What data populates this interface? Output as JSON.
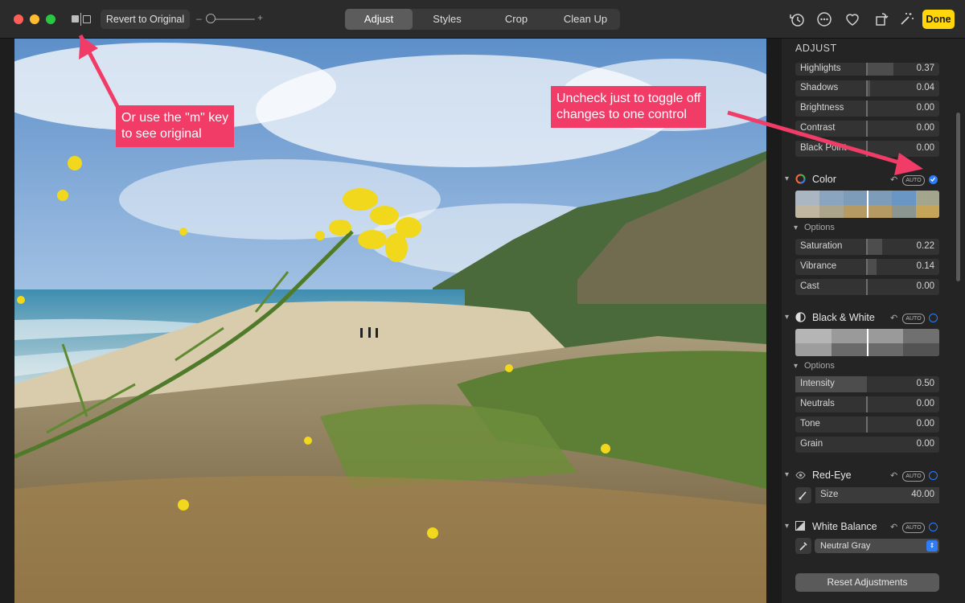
{
  "toolbar": {
    "revert_label": "Revert to Original",
    "zoom_minus": "–",
    "zoom_plus": "+",
    "tabs": [
      "Adjust",
      "Styles",
      "Crop",
      "Clean Up"
    ],
    "active_tab": "Adjust",
    "done_label": "Done"
  },
  "sidebar": {
    "header": "ADJUST",
    "light_sliders": [
      {
        "label": "Highlights",
        "value": "0.37"
      },
      {
        "label": "Shadows",
        "value": "0.04"
      },
      {
        "label": "Brightness",
        "value": "0.00"
      },
      {
        "label": "Contrast",
        "value": "0.00"
      },
      {
        "label": "Black Point",
        "value": "0.00"
      }
    ],
    "color": {
      "title": "Color",
      "auto": "AUTO",
      "options_label": "Options",
      "sliders": [
        {
          "label": "Saturation",
          "value": "0.22"
        },
        {
          "label": "Vibrance",
          "value": "0.14"
        },
        {
          "label": "Cast",
          "value": "0.00"
        }
      ]
    },
    "bw": {
      "title": "Black & White",
      "auto": "AUTO",
      "options_label": "Options",
      "sliders": [
        {
          "label": "Intensity",
          "value": "0.50"
        },
        {
          "label": "Neutrals",
          "value": "0.00"
        },
        {
          "label": "Tone",
          "value": "0.00"
        },
        {
          "label": "Grain",
          "value": "0.00"
        }
      ]
    },
    "redeye": {
      "title": "Red-Eye",
      "auto": "AUTO",
      "size_label": "Size",
      "size_value": "40.00"
    },
    "wb": {
      "title": "White Balance",
      "auto": "AUTO",
      "select_value": "Neutral Gray"
    },
    "reset_label": "Reset Adjustments"
  },
  "annotations": {
    "left": [
      "Or use the \"m\" key",
      "to see original"
    ],
    "right": [
      "Uncheck just to toggle off",
      "changes to one control"
    ],
    "color": "#f23c68"
  },
  "colors": {
    "accent": "#2f7cf6",
    "done": "#ffd60a"
  }
}
